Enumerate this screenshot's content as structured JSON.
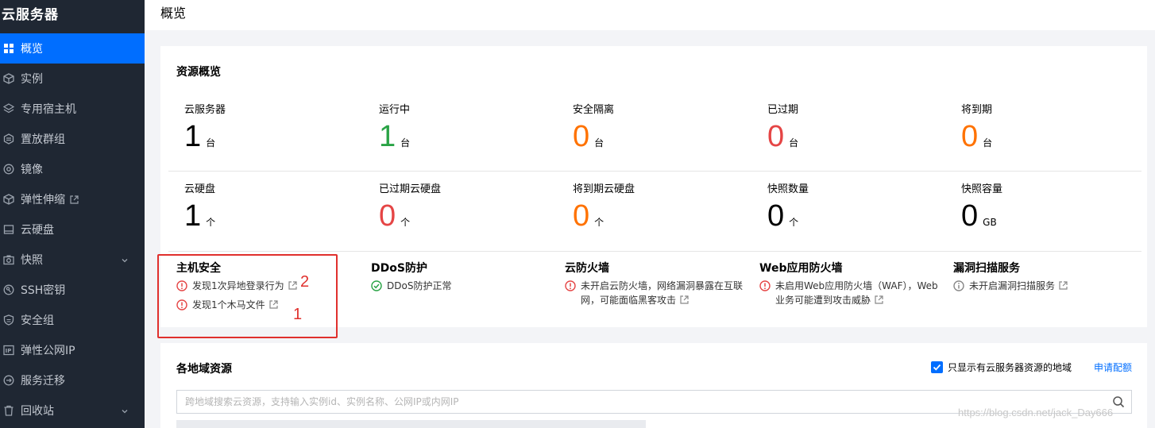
{
  "sidebar": {
    "title": "云服务器",
    "items": [
      {
        "label": "概览",
        "icon": "grid-icon",
        "active": true
      },
      {
        "label": "实例",
        "icon": "cube-icon"
      },
      {
        "label": "专用宿主机",
        "icon": "layers-icon"
      },
      {
        "label": "置放群组",
        "icon": "hexagon-group-icon"
      },
      {
        "label": "镜像",
        "icon": "disc-icon"
      },
      {
        "label": "弹性伸缩",
        "icon": "cube-icon",
        "external": true
      },
      {
        "label": "云硬盘",
        "icon": "disk-icon"
      },
      {
        "label": "快照",
        "icon": "camera-icon",
        "expandable": true
      },
      {
        "label": "SSH密钥",
        "icon": "key-icon"
      },
      {
        "label": "安全组",
        "icon": "shield-icon"
      },
      {
        "label": "弹性公网IP",
        "icon": "ip-icon"
      },
      {
        "label": "服务迁移",
        "icon": "migrate-icon"
      },
      {
        "label": "回收站",
        "icon": "trash-icon",
        "expandable": true
      }
    ]
  },
  "header": {
    "title": "概览"
  },
  "overview": {
    "title": "资源概览",
    "row1": [
      {
        "label": "云服务器",
        "value": "1",
        "unit": "台",
        "color": "#000000"
      },
      {
        "label": "运行中",
        "value": "1",
        "unit": "台",
        "color": "#29a345"
      },
      {
        "label": "安全隔离",
        "value": "0",
        "unit": "台",
        "color": "#ff7200"
      },
      {
        "label": "已过期",
        "value": "0",
        "unit": "台",
        "color": "#e54545"
      },
      {
        "label": "将到期",
        "value": "0",
        "unit": "台",
        "color": "#ff7200"
      }
    ],
    "row2": [
      {
        "label": "云硬盘",
        "value": "1",
        "unit": "个",
        "color": "#000000"
      },
      {
        "label": "已过期云硬盘",
        "value": "0",
        "unit": "个",
        "color": "#e54545"
      },
      {
        "label": "将到期云硬盘",
        "value": "0",
        "unit": "个",
        "color": "#ff7200"
      },
      {
        "label": "快照数量",
        "value": "0",
        "unit": "个",
        "color": "#000000"
      },
      {
        "label": "快照容量",
        "value": "0",
        "unit": "GB",
        "color": "#000000"
      }
    ]
  },
  "security": {
    "host": {
      "title": "主机安全",
      "line1": "发现1次异地登录行为",
      "line2": "发现1个木马文件"
    },
    "ddos": {
      "title": "DDoS防护",
      "line1": "DDoS防护正常"
    },
    "firewall": {
      "title": "云防火墙",
      "line1": "未开启云防火墙，网络漏洞暴露在互联网，可能面临黑客攻击"
    },
    "waf": {
      "title": "Web应用防火墙",
      "line1": "未启用Web应用防火墙（WAF），Web业务可能遭到攻击威胁"
    },
    "scan": {
      "title": "漏洞扫描服务",
      "line1": "未开启漏洞扫描服务"
    }
  },
  "annotations": {
    "mark1": "2",
    "mark2": "1"
  },
  "regions": {
    "title": "各地域资源",
    "checkbox_label": "只显示有云服务器资源的地域",
    "checkbox_checked": true,
    "apply_link": "申请配额",
    "search_placeholder": "跨地域搜索云资源，支持输入实例id、实例名称、公网IP或内网IP"
  },
  "watermark": "https://blog.csdn.net/jack_Day666",
  "colors": {
    "accent": "#006eff",
    "sidebar_bg": "#1f2733",
    "warning_red": "#e54545",
    "success_green": "#29a345",
    "annotation_red": "#e0302d"
  }
}
